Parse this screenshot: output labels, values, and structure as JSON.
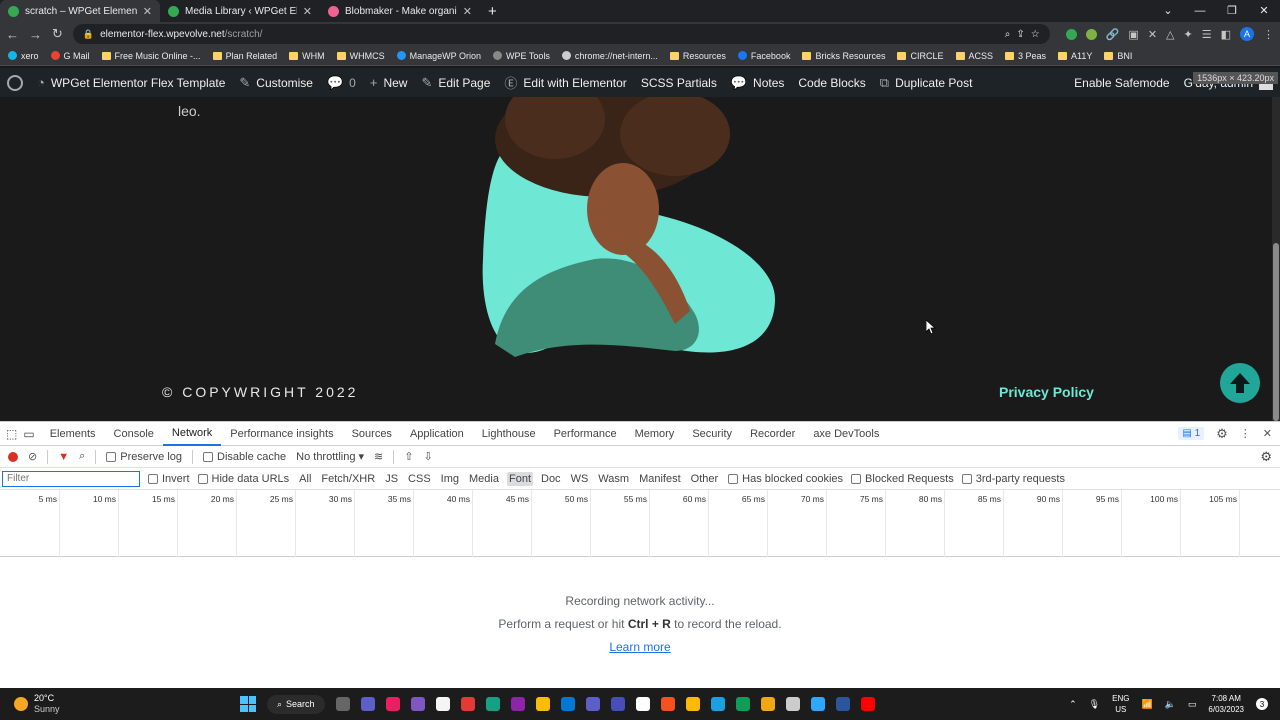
{
  "browser": {
    "tabs": [
      {
        "title": "scratch – WPGet Elementor Flex",
        "color": "#34a853",
        "active": true
      },
      {
        "title": "Media Library ‹ WPGet Elementor",
        "color": "#34a853",
        "active": false
      },
      {
        "title": "Blobmaker - Make organic SVG",
        "color": "#f06292",
        "active": false
      }
    ],
    "new_tab": "+",
    "url_host": "elementor-flex.wpevolve.net",
    "url_path": "/scratch/",
    "bookmarks": [
      "xero",
      "G Mail",
      "Free Music Online -...",
      "Plan Related",
      "WHM",
      "WHMCS",
      "ManageWP Orion",
      "WPE Tools",
      "chrome://net-intern...",
      "Resources",
      "Facebook",
      "Bricks Resources",
      "CIRCLE",
      "ACSS",
      "3 Peas",
      "A11Y",
      "BNI"
    ],
    "profile_initial": "A"
  },
  "wpbar": {
    "site_name": "WPGet Elementor Flex Template",
    "customise": "Customise",
    "comments": "0",
    "new": "New",
    "edit_page": "Edit Page",
    "edit_elementor": "Edit with Elementor",
    "scss": "SCSS Partials",
    "notes": "Notes",
    "code_blocks": "Code Blocks",
    "duplicate": "Duplicate Post",
    "safemode": "Enable Safemode",
    "greeting": "G'day, admin",
    "dimensions": "1536px × 423.20px"
  },
  "page": {
    "leo_text": "leo.",
    "copyright": "© COPYWRIGHT 2022",
    "privacy": "Privacy Policy",
    "blob_color": "#6ee7d4"
  },
  "devtools": {
    "tabs": [
      "Elements",
      "Console",
      "Network",
      "Performance insights",
      "Sources",
      "Application",
      "Lighthouse",
      "Performance",
      "Memory",
      "Security",
      "Recorder",
      "axe DevTools"
    ],
    "active_tab": "Network",
    "issues_count": "1",
    "preserve_log": "Preserve log",
    "disable_cache": "Disable cache",
    "throttling": "No throttling",
    "filter_placeholder": "Filter",
    "invert": "Invert",
    "hide_data_urls": "Hide data URLs",
    "filter_types": [
      "All",
      "Fetch/XHR",
      "JS",
      "CSS",
      "Img",
      "Media",
      "Font",
      "Doc",
      "WS",
      "Wasm",
      "Manifest",
      "Other"
    ],
    "active_filter": "Font",
    "has_blocked_cookies": "Has blocked cookies",
    "blocked_requests": "Blocked Requests",
    "third_party": "3rd-party requests",
    "timeline_ticks": [
      "5 ms",
      "10 ms",
      "15 ms",
      "20 ms",
      "25 ms",
      "30 ms",
      "35 ms",
      "40 ms",
      "45 ms",
      "50 ms",
      "55 ms",
      "60 ms",
      "65 ms",
      "70 ms",
      "75 ms",
      "80 ms",
      "85 ms",
      "90 ms",
      "95 ms",
      "100 ms",
      "105 ms",
      "1"
    ],
    "recording_msg": "Recording network activity...",
    "reload_prefix": "Perform a request or hit ",
    "reload_shortcut": "Ctrl + R",
    "reload_suffix": " to record the reload.",
    "learn_more": "Learn more"
  },
  "taskbar": {
    "temp": "20°C",
    "weather": "Sunny",
    "search": "Search",
    "lang1": "ENG",
    "lang2": "US",
    "time": "7:08 AM",
    "date": "6/03/2023",
    "notifications": "3",
    "app_colors": [
      "#666",
      "#5b5fc7",
      "#e91e63",
      "#7e57c2",
      "#f5f5f5",
      "#e53935",
      "#16a085",
      "#8e24aa",
      "#fbbc04",
      "#0078d4",
      "#5b5fc7",
      "#464eb8",
      "#ffffff",
      "#f4511e",
      "#ffb900",
      "#1ba1e2",
      "#0f9d58",
      "#f3a712",
      "#cccccc",
      "#31a8ff",
      "#2b579a",
      "#ff0000"
    ]
  }
}
